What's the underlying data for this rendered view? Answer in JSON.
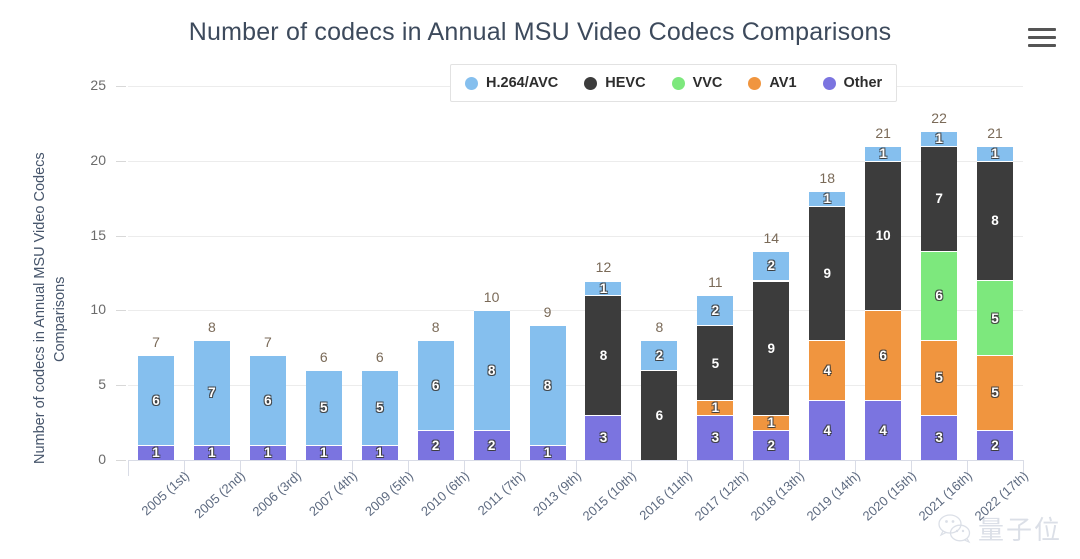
{
  "header": {
    "title": "Number of codecs in Annual MSU Video Codecs Comparisons",
    "menu_icon": "hamburger-menu-icon"
  },
  "watermark": {
    "text": "量子位",
    "icon": "wechat-icon"
  },
  "chart_data": {
    "type": "bar",
    "subtype": "stacked",
    "title": "Number of codecs in Annual MSU Video Codecs Comparisons",
    "xlabel": "",
    "ylabel": "Number of codecs  in Annual MSU Video Codecs Comparisons",
    "ylabel_lines": [
      "Number of codecs  in Annual MSU Video Codecs",
      "Comparisons"
    ],
    "ylim": [
      0,
      25
    ],
    "yticks": [
      0,
      5,
      10,
      15,
      20,
      25
    ],
    "grid": true,
    "legend_position": "top-center",
    "categories": [
      "2005 (1st)",
      "2005 (2nd)",
      "2006 (3rd)",
      "2007 (4th)",
      "2009 (5th)",
      "2010 (6th)",
      "2011 (7th)",
      "2013 (9th)",
      "2015 (10th)",
      "2016 (11th)",
      "2017 (12th)",
      "2018 (13th)",
      "2019 (14th)",
      "2020 (15th)",
      "2021 (16th)",
      "2022 (17th)"
    ],
    "stack_order_bottom_to_top": [
      "Other",
      "AV1",
      "VVC",
      "HEVC",
      "H.264/AVC"
    ],
    "series": [
      {
        "name": "Other",
        "color": "#7b74e0",
        "values": [
          1,
          1,
          1,
          1,
          1,
          2,
          2,
          1,
          3,
          0,
          3,
          2,
          4,
          4,
          3,
          2
        ]
      },
      {
        "name": "AV1",
        "color": "#f0953f",
        "values": [
          0,
          0,
          0,
          0,
          0,
          0,
          0,
          0,
          0,
          0,
          1,
          1,
          4,
          6,
          5,
          5
        ]
      },
      {
        "name": "VVC",
        "color": "#7de87d",
        "values": [
          0,
          0,
          0,
          0,
          0,
          0,
          0,
          0,
          0,
          0,
          0,
          0,
          0,
          0,
          6,
          5
        ]
      },
      {
        "name": "HEVC",
        "color": "#3c3c3c",
        "values": [
          0,
          0,
          0,
          0,
          0,
          0,
          0,
          0,
          8,
          6,
          5,
          9,
          9,
          10,
          7,
          8
        ]
      },
      {
        "name": "H.264/AVC",
        "color": "#85bfee",
        "values": [
          6,
          7,
          6,
          5,
          5,
          6,
          8,
          8,
          1,
          2,
          2,
          2,
          1,
          1,
          1,
          1
        ]
      }
    ],
    "totals": [
      7,
      8,
      7,
      6,
      6,
      8,
      10,
      9,
      12,
      8,
      11,
      14,
      18,
      21,
      22,
      21
    ]
  },
  "legend": {
    "items": [
      {
        "label": "H.264/AVC",
        "color": "#85bfee"
      },
      {
        "label": "HEVC",
        "color": "#3c3c3c"
      },
      {
        "label": "VVC",
        "color": "#7de87d"
      },
      {
        "label": "AV1",
        "color": "#f0953f"
      },
      {
        "label": "Other",
        "color": "#7b74e0"
      }
    ]
  }
}
